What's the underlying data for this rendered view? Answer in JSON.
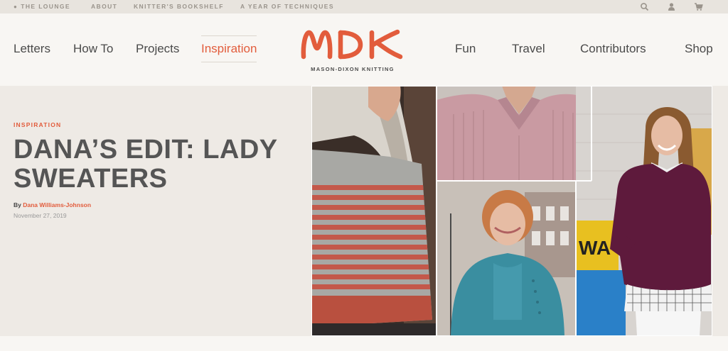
{
  "topbar": {
    "links": [
      {
        "label": "THE LOUNGE",
        "icon": "chat-icon"
      },
      {
        "label": "ABOUT"
      },
      {
        "label": "KNITTER'S BOOKSHELF"
      },
      {
        "label": "A YEAR OF TECHNIQUES"
      }
    ],
    "icons": [
      "search-icon",
      "user-icon",
      "cart-icon"
    ]
  },
  "nav": {
    "left": [
      "Letters",
      "How To",
      "Projects",
      "Inspiration"
    ],
    "right": [
      "Fun",
      "Travel",
      "Contributors",
      "Shop"
    ],
    "active": "Inspiration"
  },
  "logo": {
    "wordmark": "MDK",
    "subtitle": "MASON-DIXON KNITTING"
  },
  "article": {
    "kicker": "INSPIRATION",
    "title_line1": "DANA’S EDIT: LADY",
    "title_line2": "SWEATERS",
    "by_prefix": "By",
    "author": "Dana Williams-Johnson",
    "date": "November 27, 2019"
  },
  "colors": {
    "accent": "#e25c3c",
    "background": "#f8f6f3",
    "content_bg": "#eeeae5",
    "text": "#555555"
  }
}
